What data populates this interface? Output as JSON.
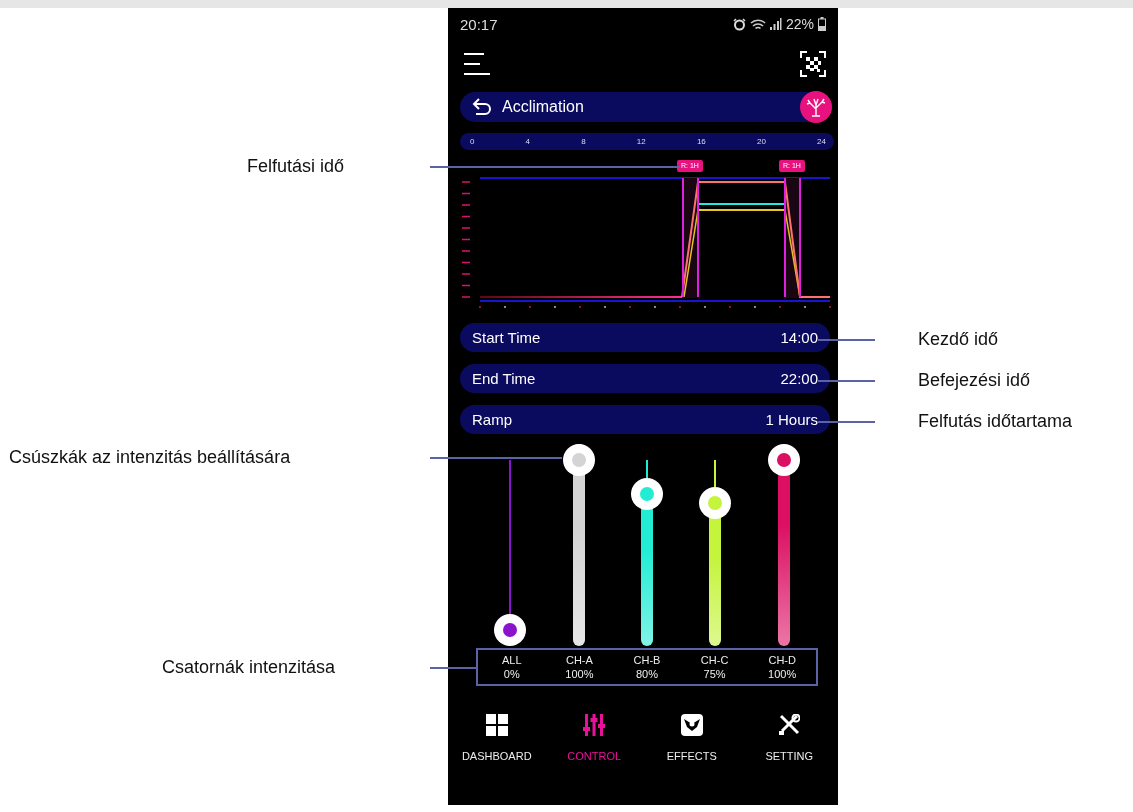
{
  "status_bar": {
    "time": "20:17",
    "battery": "22%"
  },
  "header": {
    "title": "Acclimation"
  },
  "hour_scale": [
    "0",
    "4",
    "8",
    "12",
    "16",
    "20",
    "24"
  ],
  "ramp_badges": [
    "R: 1H",
    "R: 1H"
  ],
  "settings": [
    {
      "label": "Start Time",
      "value": "14:00"
    },
    {
      "label": "End Time",
      "value": "22:00"
    },
    {
      "label": "Ramp",
      "value": "1 Hours"
    }
  ],
  "channels": [
    {
      "name": "ALL",
      "value": "0%",
      "level": 0,
      "color": "#8a14cc"
    },
    {
      "name": "CH-A",
      "value": "100%",
      "level": 1,
      "color": "#d4d4d4"
    },
    {
      "name": "CH-B",
      "value": "80%",
      "level": 0.8,
      "color": "#22ecd4"
    },
    {
      "name": "CH-C",
      "value": "75%",
      "level": 0.75,
      "color": "#c4f43c"
    },
    {
      "name": "CH-D",
      "value": "100%",
      "level": 1,
      "color": "#dc1062"
    }
  ],
  "nav": [
    {
      "label": "DASHBOARD",
      "selected": false
    },
    {
      "label": "CONTROL",
      "selected": true
    },
    {
      "label": "EFFECTS",
      "selected": false
    },
    {
      "label": "SETTING",
      "selected": false
    }
  ],
  "annotations": [
    {
      "text": "Felfutási idő"
    },
    {
      "text": "Kezdő idő"
    },
    {
      "text": "Befejezési idő"
    },
    {
      "text": "Felfutás időtartama"
    },
    {
      "text": "Csúszkák az intenzitás beállítására"
    },
    {
      "text": "Csatornák intenzitása"
    }
  ]
}
